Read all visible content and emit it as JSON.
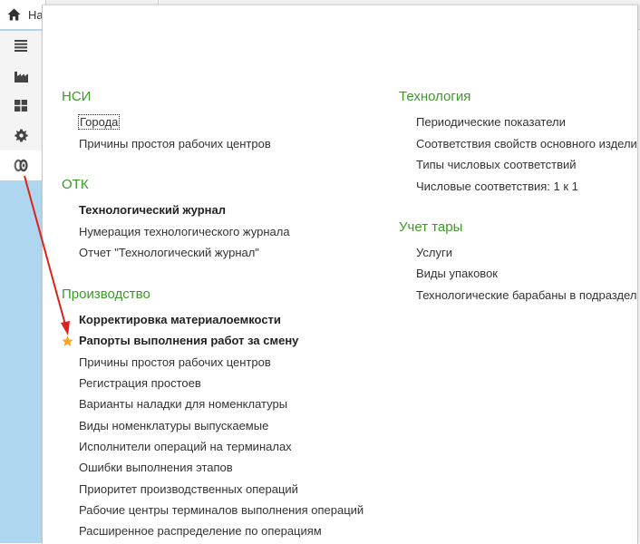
{
  "tabs": {
    "home_label": "На"
  },
  "sidebar": {
    "items": [
      {
        "icon": "list-icon"
      },
      {
        "icon": "factory-icon"
      },
      {
        "icon": "grid-icon"
      },
      {
        "icon": "gear-icon"
      },
      {
        "icon": "reels-icon",
        "active": true
      }
    ]
  },
  "sections": {
    "nsi": {
      "title": "НСИ",
      "items": [
        "Города",
        "Причины простоя рабочих центров"
      ]
    },
    "otk": {
      "title": "ОТК",
      "items": [
        "Технологический журнал",
        "Нумерация технологического журнала",
        "Отчет \"Технологический журнал\""
      ]
    },
    "production": {
      "title": "Производство",
      "items": [
        "Корректировка материалоемкости",
        "Рапорты выполнения работ за смену",
        "Причины простоя рабочих центров",
        "Регистрация простоев",
        "Варианты наладки для номенклатуры",
        "Виды номенклатуры выпускаемые",
        "Исполнители операций на терминалах",
        "Ошибки выполнения этапов",
        "Приоритет производственных операций",
        "Рабочие центры терминалов выполнения операций",
        "Расширенное распределение по операциям"
      ]
    },
    "technology": {
      "title": "Технология",
      "items": [
        "Периодические показатели",
        "Соответствия свойств основного издели",
        "Типы числовых соответствий",
        "Числовые соответствия: 1 к 1"
      ]
    },
    "tare": {
      "title": "Учет тары",
      "items": [
        "Услуги",
        "Виды упаковок",
        "Технологические барабаны в подразделе"
      ]
    }
  },
  "colors": {
    "section_title": "#3b9a26",
    "sidebar_bg": "#aed7ef",
    "star": "#f5a623",
    "annotation_arrow": "#e0201a"
  }
}
